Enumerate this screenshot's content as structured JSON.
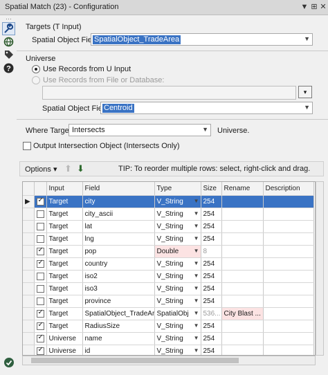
{
  "window": {
    "title": "Spatial Match (23) - Configuration",
    "controls": {
      "pin": "▼",
      "float": "⊞",
      "close": "✕"
    }
  },
  "sidebar": {
    "icons": [
      "configuration-wrench-icon",
      "globe-icon",
      "tag-icon",
      "help-icon"
    ]
  },
  "targets": {
    "group_label": "Targets (T Input)",
    "spatial_field_label": "Spatial Object Field:",
    "spatial_field_value": "SpatialObject_TradeArea"
  },
  "universe": {
    "group_label": "Universe",
    "option_u_input": "Use Records from U Input",
    "option_file": "Use Records from File or Database:",
    "file_path": "",
    "browse_button": "▾",
    "spatial_field_label": "Spatial Object Field:",
    "spatial_field_value": "Centroid"
  },
  "where": {
    "label": "Where Target",
    "value": "Intersects",
    "suffix": "Universe."
  },
  "output_intersection": {
    "label": "Output Intersection Object (Intersects Only)",
    "checked": false
  },
  "toolbar": {
    "options_label": "Options",
    "options_caret": "▾",
    "up_arrow": "⬆",
    "down_arrow": "⬇",
    "tip": "TIP: To reorder multiple rows: select, right-click and drag."
  },
  "table": {
    "headers": [
      "",
      "",
      "Input",
      "Field",
      "Type",
      "Size",
      "Rename",
      "Description"
    ],
    "rows": [
      {
        "marker": "▶",
        "checked": true,
        "input": "Target",
        "field": "city",
        "type": "V_String",
        "size": "254",
        "rename": "",
        "description": "",
        "selected": true
      },
      {
        "marker": "",
        "checked": false,
        "input": "Target",
        "field": "city_ascii",
        "type": "V_String",
        "size": "254",
        "rename": "",
        "description": ""
      },
      {
        "marker": "",
        "checked": false,
        "input": "Target",
        "field": "lat",
        "type": "V_String",
        "size": "254",
        "rename": "",
        "description": ""
      },
      {
        "marker": "",
        "checked": false,
        "input": "Target",
        "field": "lng",
        "type": "V_String",
        "size": "254",
        "rename": "",
        "description": ""
      },
      {
        "marker": "",
        "checked": true,
        "input": "Target",
        "field": "pop",
        "type": "Double",
        "size": "8",
        "rename": "",
        "description": "",
        "highlight_type": true,
        "dim_size": true
      },
      {
        "marker": "",
        "checked": true,
        "input": "Target",
        "field": "country",
        "type": "V_String",
        "size": "254",
        "rename": "",
        "description": ""
      },
      {
        "marker": "",
        "checked": false,
        "input": "Target",
        "field": "iso2",
        "type": "V_String",
        "size": "254",
        "rename": "",
        "description": ""
      },
      {
        "marker": "",
        "checked": false,
        "input": "Target",
        "field": "iso3",
        "type": "V_String",
        "size": "254",
        "rename": "",
        "description": ""
      },
      {
        "marker": "",
        "checked": false,
        "input": "Target",
        "field": "province",
        "type": "V_String",
        "size": "254",
        "rename": "",
        "description": ""
      },
      {
        "marker": "",
        "checked": true,
        "input": "Target",
        "field": "SpatialObject_TradeArea",
        "type": "SpatialObj",
        "size": "536...",
        "rename": "City Blast ...",
        "description": "",
        "dim_size": true,
        "highlight_rename": true
      },
      {
        "marker": "",
        "checked": true,
        "input": "Target",
        "field": "RadiusSize",
        "type": "V_String",
        "size": "254",
        "rename": "",
        "description": ""
      },
      {
        "marker": "",
        "checked": true,
        "input": "Universe",
        "field": "name",
        "type": "V_String",
        "size": "254",
        "rename": "",
        "description": ""
      },
      {
        "marker": "",
        "checked": true,
        "input": "Universe",
        "field": "id",
        "type": "V_String",
        "size": "254",
        "rename": "",
        "description": ""
      }
    ]
  },
  "status": {
    "icon": "checkmark-circle-icon"
  },
  "colors": {
    "selection": "#3a73c4",
    "highlight": "#fce3e3"
  }
}
